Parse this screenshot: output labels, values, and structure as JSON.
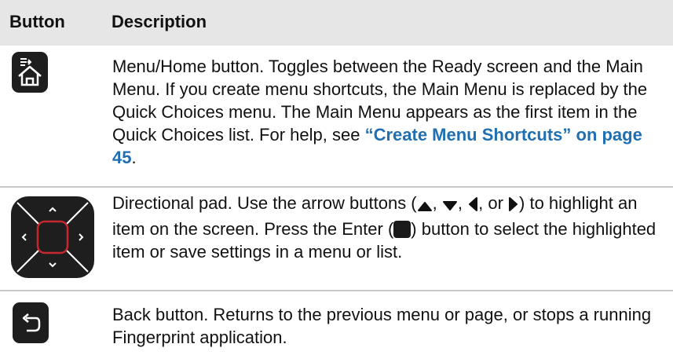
{
  "header": {
    "button_label": "Button",
    "description_label": "Description"
  },
  "rows": [
    {
      "icon": "menu-home-icon",
      "text": "Menu/Home button. Toggles between the Ready screen and the Main Menu. If you create menu shortcuts, the Main Menu is replaced by the Quick Choices menu. The Main Menu appears as the first item in the Quick Choices list. For help, see ",
      "link": "“Create Menu Shortcuts” on page 45",
      "text_after_link": "."
    },
    {
      "icon": "directional-pad-icon",
      "text_part1": "Directional pad. Use the arrow buttons (",
      "sep_1": ", ",
      "sep_2": ", ",
      "sep_3": ", or ",
      "text_part2": ") to highlight an item on the screen. Press the Enter (",
      "text_part3": ") button to select the highlighted item or save settings in a menu or list."
    },
    {
      "icon": "back-icon",
      "text": "Back button. Returns to the previous menu or page, or stops a running Fingerprint application."
    }
  ],
  "colors": {
    "header_bg": "#e6e6e6",
    "link": "#1f6fb2",
    "icon_bg": "#1e1e1e",
    "enter_outline": "#c8262e"
  }
}
